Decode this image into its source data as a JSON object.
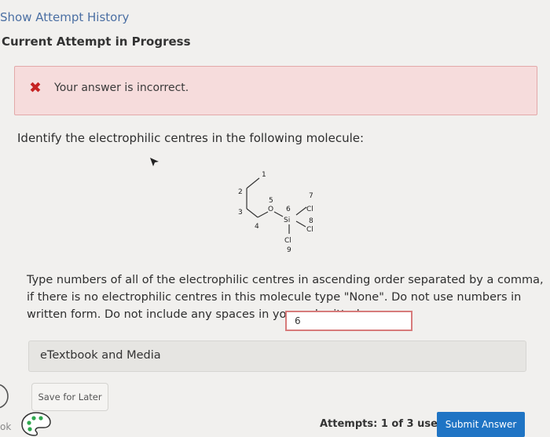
{
  "header": {
    "show_history": "Show Attempt History",
    "current_attempt": "Current Attempt in Progress"
  },
  "feedback": {
    "icon": "x-icon",
    "message": "Your answer is incorrect."
  },
  "question": {
    "prompt": "Identify the electrophilic centres in the following molecule:",
    "instructions": "Type numbers of all of the electrophilic centres in ascending order separated by a comma, if there is no electrophilic centres in this molecule type \"None\". Do not use numbers in written form. Do not include any spaces in your submitted answer.",
    "answer_value": "6"
  },
  "molecule": {
    "labels": {
      "c1": "1",
      "c2": "2",
      "c3": "3",
      "c4": "4",
      "o5_num": "5",
      "o5": "O",
      "si6_num": "6",
      "si": "Si",
      "cl7_num": "7",
      "cl7": "Cl",
      "cl8_num": "8",
      "cl8": "Cl",
      "cl9": "Cl",
      "cl9_num": "9"
    }
  },
  "resources": {
    "etextbook": "eTextbook and Media"
  },
  "footer": {
    "save_later": "Save for Later",
    "attempts": "Attempts: 1 of 3 used",
    "submit": "Submit Answer"
  },
  "edge": {
    "text": "ok"
  },
  "colors": {
    "link": "#4b6fa3",
    "error_bg": "#f6dcdc",
    "error_border": "#e3a9a9",
    "error_icon": "#c62323",
    "submit_bg": "#1f74c4"
  }
}
